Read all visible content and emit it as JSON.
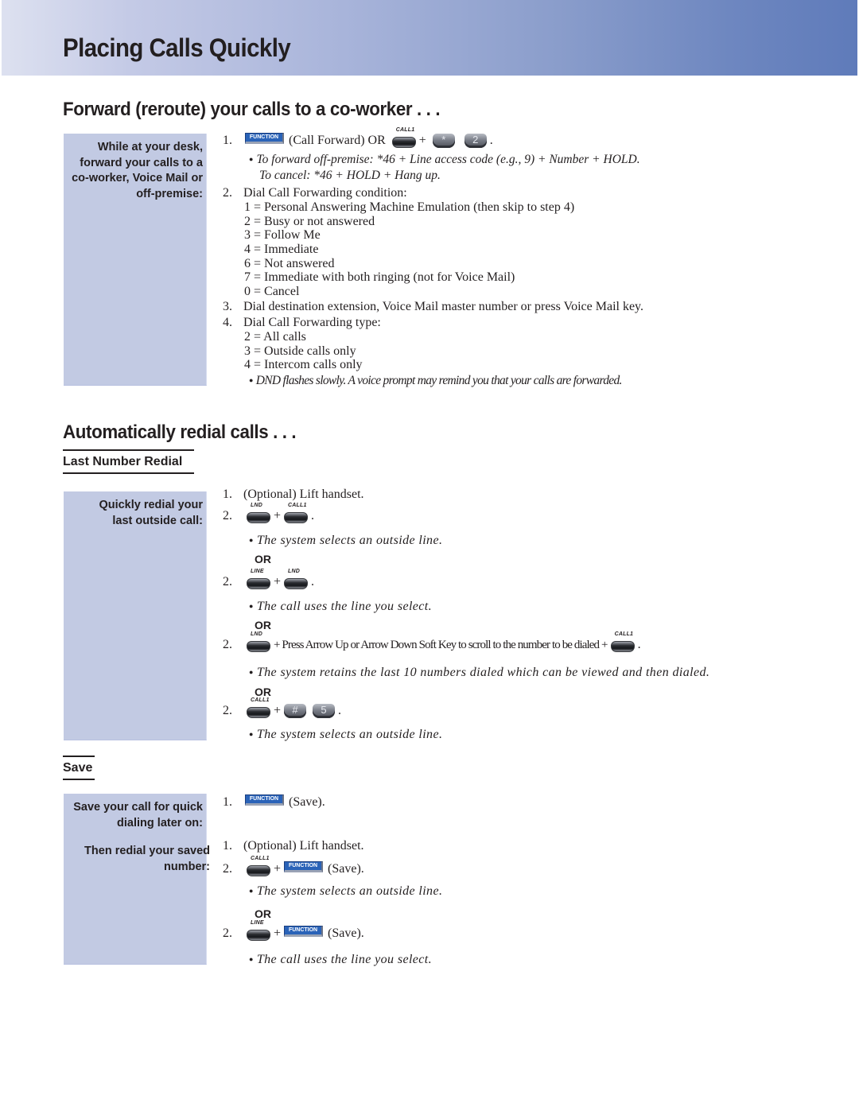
{
  "page_title": "Placing Calls Quickly",
  "colors": {
    "banner_start": "#dde1f0",
    "banner_end": "#5f7bba",
    "sidebox": "#c2cae3",
    "function_key": "#2a63b8"
  },
  "icons": {
    "function_key": "FUNCTION",
    "call1_key": "CALL1",
    "lnd_key": "LND",
    "line_key": "LINE",
    "star_key": "*",
    "two_key": "2",
    "hash_key": "#",
    "five_key": "5"
  },
  "forward": {
    "heading": "Forward (reroute) your calls to a co-worker . . .",
    "sidebar": "While at your desk, forward your calls to a co-worker, Voice Mail or off-premise:",
    "step1_num": "1.",
    "step1_text": "(Call Forward) OR",
    "plus": "+",
    "period": ".",
    "note1": "To forward off-premise: *46 + Line access code (e.g., 9) + Number + HOLD.",
    "note1b": "To cancel: *46 + HOLD + Hang up.",
    "step2_num": "2.",
    "step2_text": "Dial Call Forwarding condition:",
    "conditions": [
      "1 = Personal Answering Machine Emulation (then skip to step 4)",
      "2 = Busy or not answered",
      "3 = Follow Me",
      "4 = Immediate",
      "6 = Not answered",
      "7 = Immediate with both ringing (not for Voice Mail)",
      "0 = Cancel"
    ],
    "step3_num": "3.",
    "step3_text": "Dial destination extension, Voice Mail master number or press Voice Mail key.",
    "step4_num": "4.",
    "step4_text": "Dial Call Forwarding type:",
    "types": [
      "2 = All calls",
      "3 = Outside calls only",
      "4 = Intercom calls only"
    ],
    "note_dnd": "DND flashes slowly. A voice prompt may remind you that your calls are forwarded."
  },
  "redial": {
    "heading": "Automatically redial calls . . .",
    "lnr_heading": "Last Number Redial",
    "lnr_sidebar": "Quickly redial your last outside call:",
    "or_label": "OR",
    "s1_num": "1.",
    "s1_text": "(Optional) Lift handset.",
    "s2_num": "2.",
    "note_outside": "The system selects an outside line.",
    "note_line": "The call uses the line you select.",
    "scroll_text": "+ Press Arrow Up or Arrow Down Soft Key to scroll to the number to be dialed +",
    "note_retains": "The system retains the last 10 numbers dialed which can be viewed and then dialed.",
    "save_heading": "Save",
    "save_sidebar1": "Save your call for quick dialing later on:",
    "save_sidebar2": "Then redial your saved number:",
    "save_step": "(Save).",
    "save_step_period": "."
  }
}
